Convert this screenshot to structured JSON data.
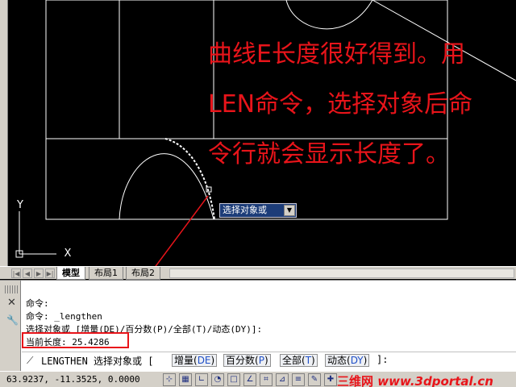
{
  "annotations": {
    "line1": "曲线E长度很好得到。用",
    "line2": "LEN命令，选择对象后命",
    "line3": "令行就会显示长度了。"
  },
  "tooltip": {
    "text": "选择对象或",
    "dropdown_icon": "dropdown-arrow-icon"
  },
  "ucs": {
    "x_label": "X",
    "y_label": "Y"
  },
  "layout_tabs": {
    "tabs": [
      "模型",
      "布局1",
      "布局2"
    ],
    "active": "模型"
  },
  "command_history": {
    "lines": [
      "命令:",
      "命令: _lengthen",
      "选择对象或 [增量(DE)/百分数(P)/全部(T)/动态(DY)]:",
      "当前长度: 25.4286"
    ]
  },
  "command_prompt": {
    "lead": "LENGTHEN 选择对象或 [",
    "options": [
      {
        "label": "增量(",
        "key": "DE",
        "end": ")"
      },
      {
        "label": "百分数(",
        "key": "P",
        "end": ")"
      },
      {
        "label": "全部(",
        "key": "T",
        "end": ")"
      },
      {
        "label": "动态(",
        "key": "DY",
        "end": ")"
      }
    ],
    "tail": "]:"
  },
  "status_bar": {
    "coords": "63.9237,  -11.3525, 0.0000",
    "watermark_brand": "三维网",
    "watermark_url": "www.3dportal.cn"
  },
  "colors": {
    "annotation_red": "#e8141a",
    "canvas_bg": "#000000",
    "tooltip_bg": "#1c3c78",
    "keyword_blue": "#2050c8"
  }
}
